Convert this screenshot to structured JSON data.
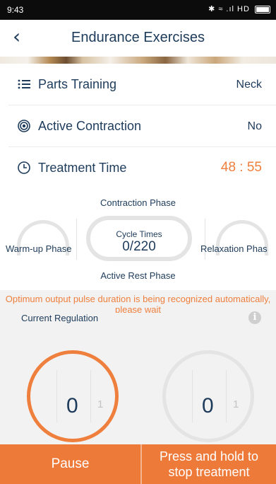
{
  "status_bar": {
    "time": "9:43",
    "indicators": "✱ ≈ .ıl HD"
  },
  "nav": {
    "title": "Endurance Exercises",
    "back_icon": "chevron-left-icon"
  },
  "settings": [
    {
      "label": "Parts Training",
      "value": "Neck",
      "icon": "list-icon"
    },
    {
      "label": "Active Contraction",
      "value": "No",
      "icon": "target-icon"
    },
    {
      "label": "Treatment Time",
      "value": "48 : 55",
      "icon": "clock-icon",
      "value_color": "#ef7f3d"
    }
  ],
  "phases": {
    "top": "Contraction Phase",
    "left": "Warm-up Phase",
    "right": "Relaxation Phas",
    "bottom": "Active Rest Phase",
    "cycle_label": "Cycle Times",
    "cycle_value": "0/220"
  },
  "regulation": {
    "notice": "Optimum output pulse duration is being recognized automatically, please wait",
    "label": "Current Regulation",
    "left_dial": {
      "value": "0",
      "next": "1"
    },
    "right_dial": {
      "value": "0",
      "next": "1"
    }
  },
  "buttons": {
    "pause": "Pause",
    "stop_line1": "Press and hold to",
    "stop_line2": "stop treatment"
  },
  "colors": {
    "accent": "#ef7f3d",
    "text": "#1d3b5a",
    "button": "#ee7a3a"
  }
}
